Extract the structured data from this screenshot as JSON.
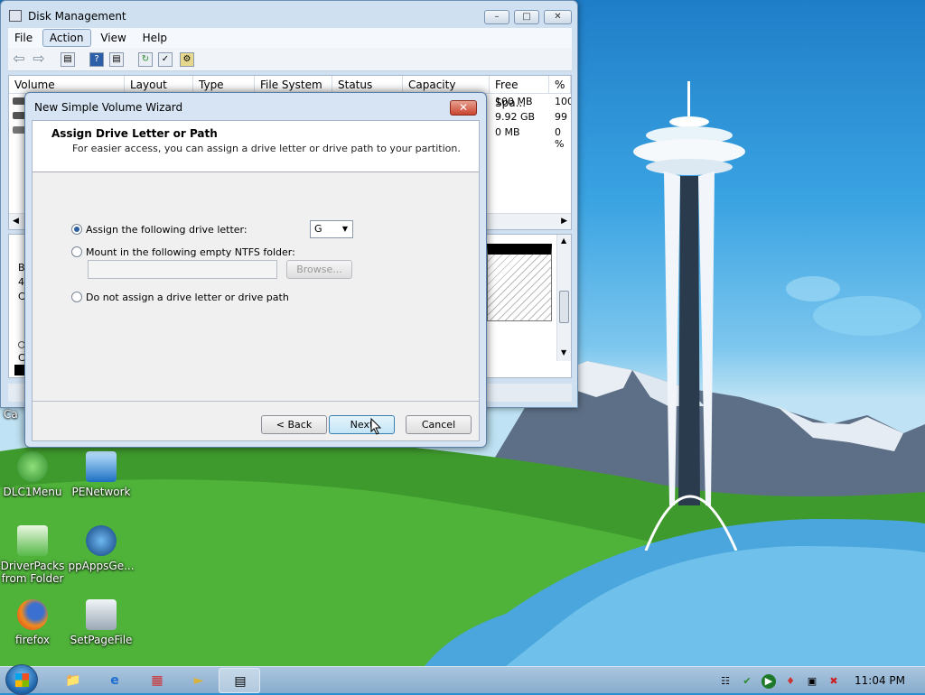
{
  "desktop": {
    "icons": [
      {
        "label": "DLC1Menu",
        "icon": "dlc1menu-icon"
      },
      {
        "label": "PENetwork",
        "icon": "network-computer-icon"
      },
      {
        "label": "DriverPacks from Folder",
        "icon": "driverpacks-icon"
      },
      {
        "label": "ppAppsGe...",
        "icon": "ppapps-icon"
      },
      {
        "label": "firefox",
        "icon": "firefox-icon"
      },
      {
        "label": "SetPageFile",
        "icon": "setpagefile-icon"
      }
    ],
    "partial_icon_label": "Ca"
  },
  "disk_management": {
    "title": "Disk Management",
    "menu": [
      "File",
      "Action",
      "View",
      "Help"
    ],
    "selected_menu": "Action",
    "columns": [
      "Volume",
      "Layout",
      "Type",
      "File System",
      "Status",
      "Capacity",
      "Free Spa...",
      "% F"
    ],
    "rows": [
      {
        "free_space": "100 MB",
        "pct": "100"
      },
      {
        "free_space": "9.92 GB",
        "pct": "99"
      },
      {
        "free_space": "0 MB",
        "pct": "0 %"
      }
    ],
    "lower_left_glyphs": [
      "B",
      "4",
      "C"
    ],
    "lower_left_glyphs2": [
      "C"
    ]
  },
  "wizard": {
    "title": "New Simple Volume Wizard",
    "close_label": "✕",
    "heading": "Assign Drive Letter or Path",
    "subheading": "For easier access, you can assign a drive letter or drive path to your partition.",
    "options": [
      {
        "label": "Assign the following drive letter:",
        "selected": true
      },
      {
        "label": "Mount in the following empty NTFS folder:",
        "selected": false
      },
      {
        "label": "Do not assign a drive letter or drive path",
        "selected": false
      }
    ],
    "drive_letter": "G",
    "browse_label": "Browse...",
    "back_label": "< Back",
    "next_label": "Next",
    "cancel_label": "Cancel"
  },
  "taskbar": {
    "clock": "11:04 PM",
    "pinned": [
      "explorer-icon",
      "ie-icon",
      "network-icon",
      "chat-icon",
      "disk-management-icon"
    ],
    "tray": [
      "network-tray-icon",
      "security-tray-icon",
      "play-tray-icon",
      "bluetooth-tray-icon",
      "display-tray-icon",
      "volume-muted-tray-icon"
    ]
  },
  "colors": {
    "accent": "#2a5e9e",
    "window_frame": "#cfe0f1",
    "taskbar": "#9ab9d8"
  }
}
